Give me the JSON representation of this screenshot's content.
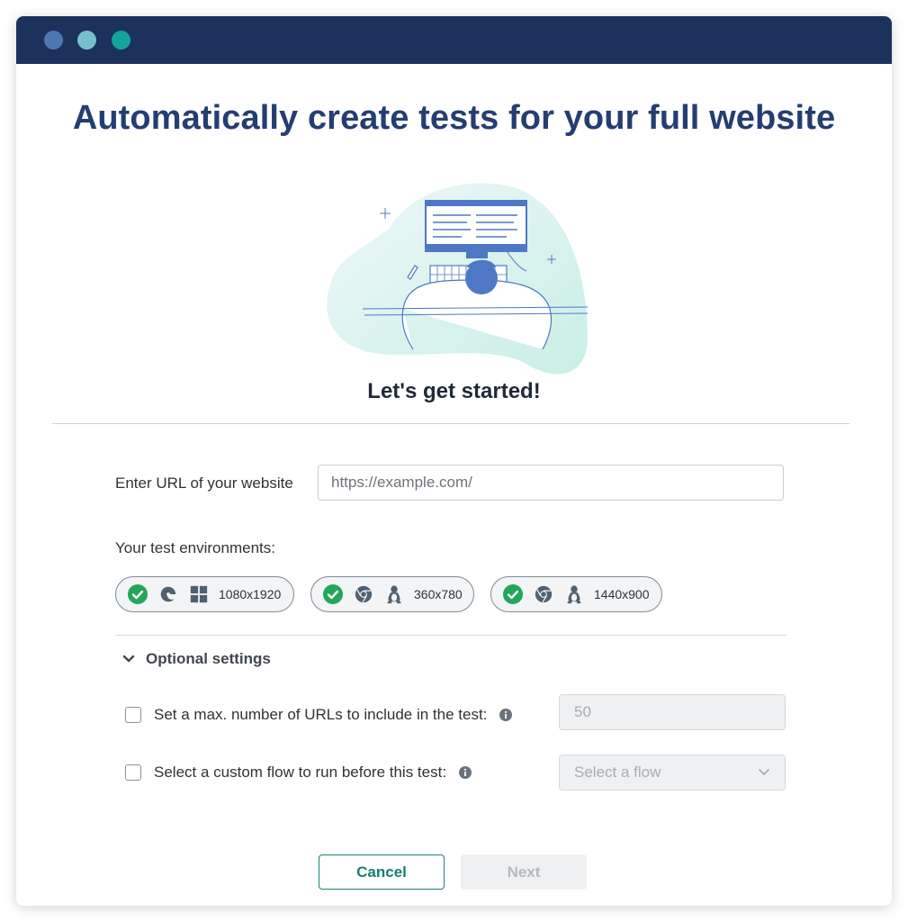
{
  "headline": "Automatically create tests for your full website",
  "subhead": "Let's get started!",
  "url": {
    "label": "Enter URL of your website",
    "placeholder": "https://example.com/",
    "value": ""
  },
  "environments": {
    "label": "Your test environments:",
    "items": [
      {
        "browser_icon": "edge-icon",
        "os_icon": "windows-icon",
        "resolution": "1080x1920",
        "status": "check-circle-icon"
      },
      {
        "browser_icon": "chrome-icon",
        "os_icon": "linux-icon",
        "resolution": "360x780",
        "status": "check-circle-icon"
      },
      {
        "browser_icon": "chrome-icon",
        "os_icon": "linux-icon",
        "resolution": "1440x900",
        "status": "check-circle-icon"
      }
    ]
  },
  "optional": {
    "toggle_label": "Optional settings",
    "max_urls": {
      "label": "Set a max. number of URLs to include in the test:",
      "value": "50",
      "checked": false
    },
    "custom_flow": {
      "label": "Select a custom flow to run before this test:",
      "placeholder": "Select a flow",
      "checked": false
    }
  },
  "buttons": {
    "cancel": "Cancel",
    "next": "Next"
  },
  "colors": {
    "titlebar": "#1c325b",
    "headline": "#243e72",
    "accent": "#1a8077",
    "check_green": "#22a75a"
  }
}
